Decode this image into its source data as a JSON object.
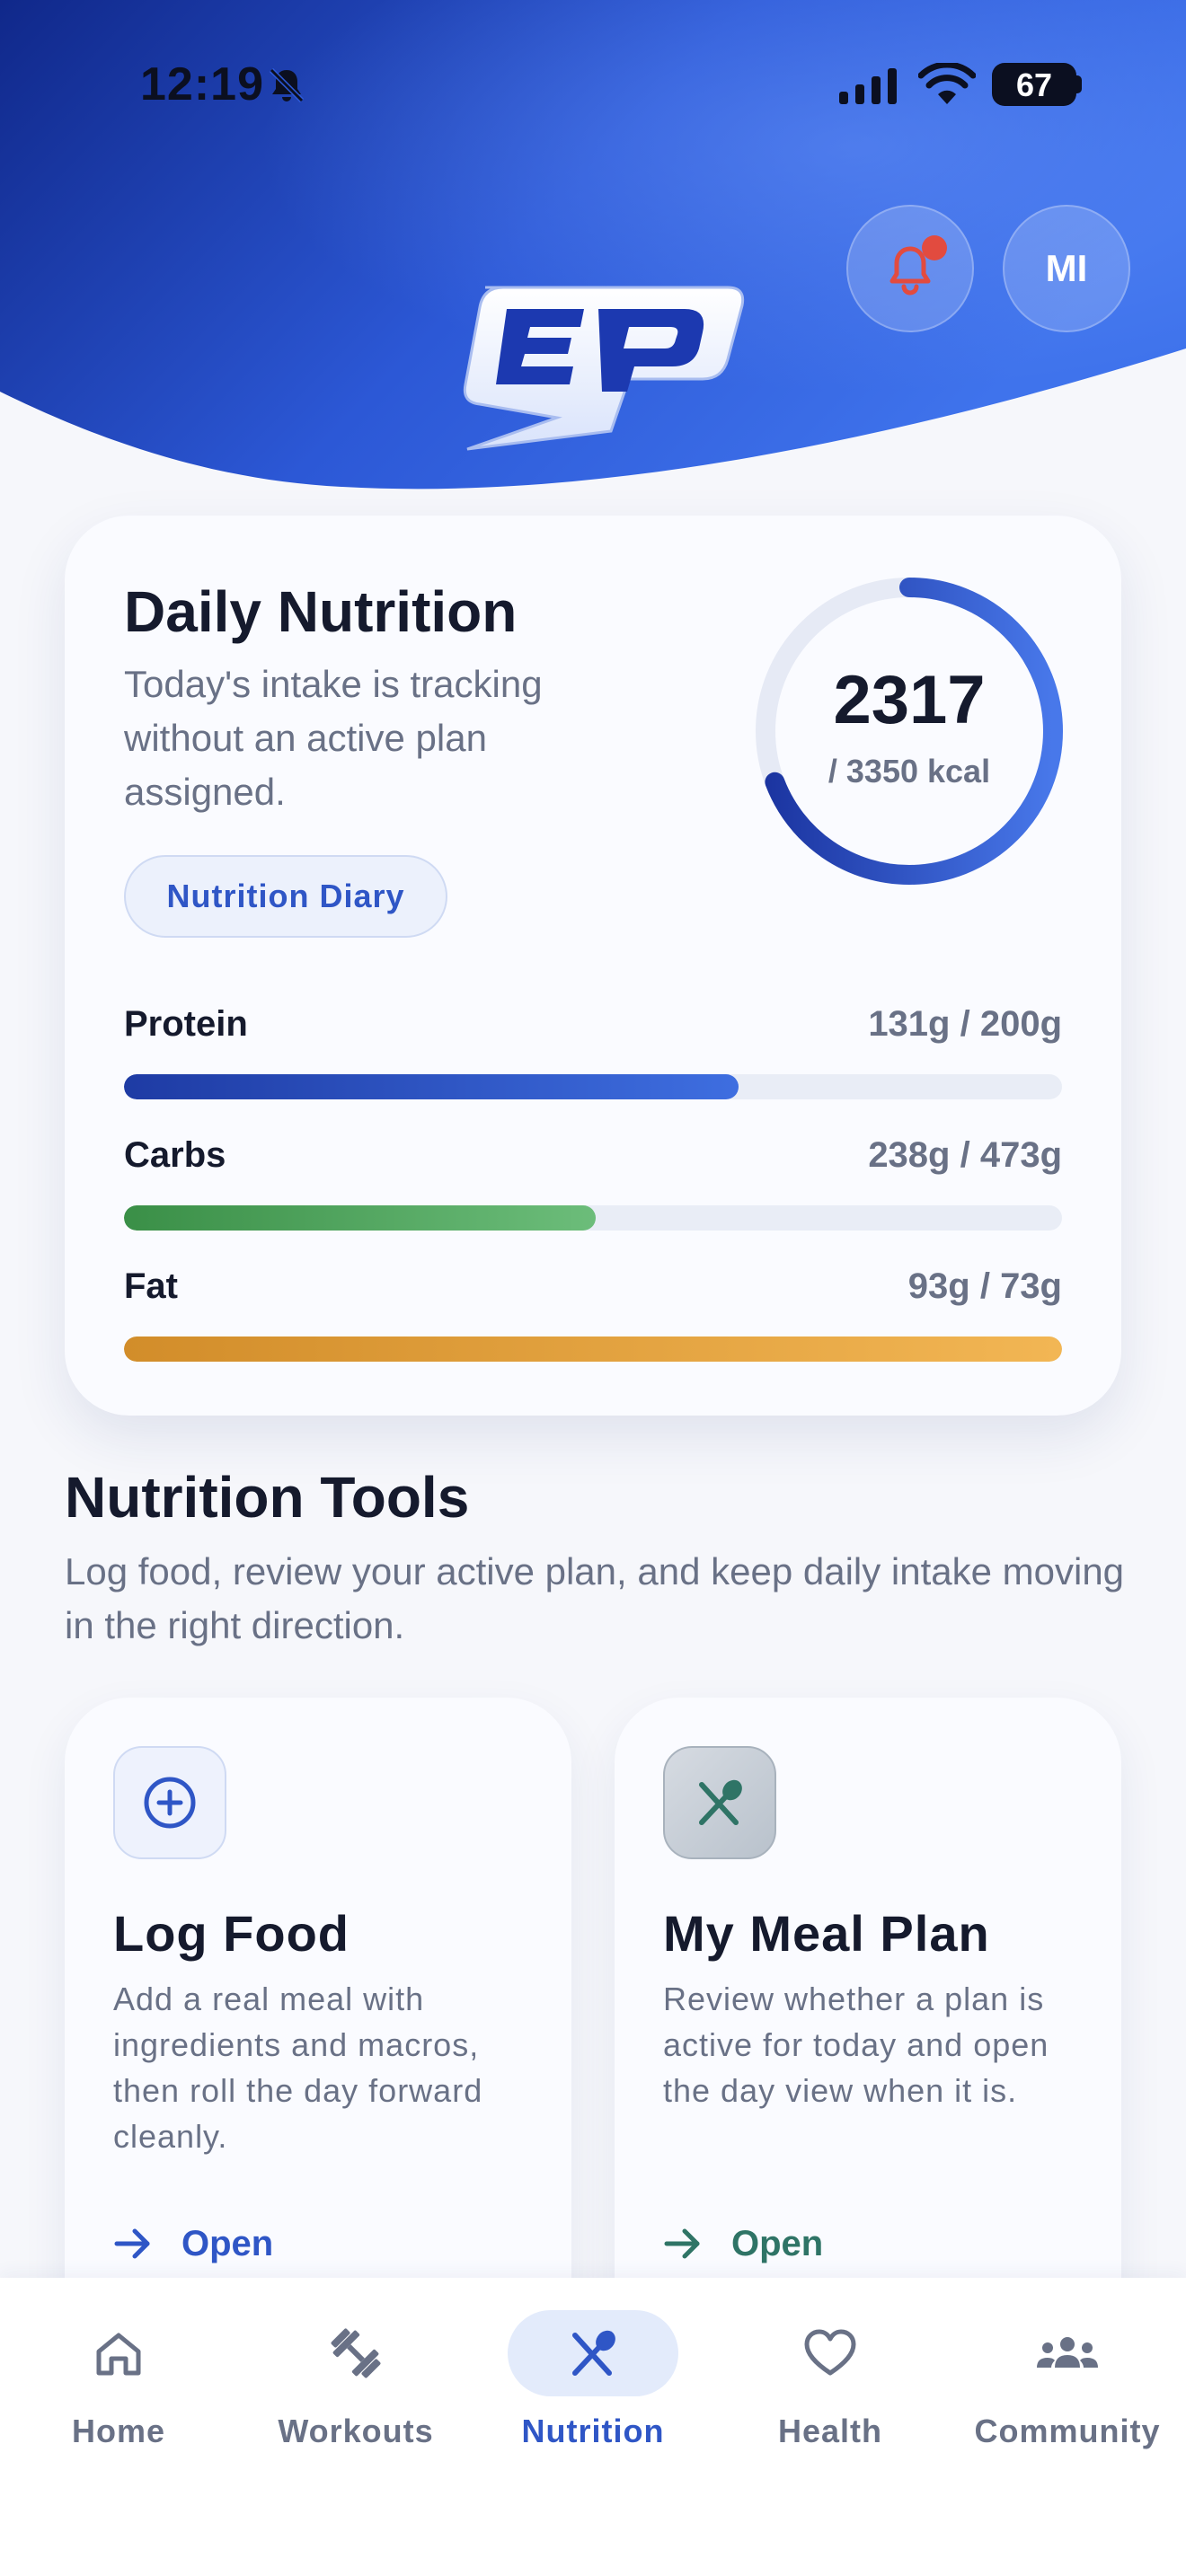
{
  "status_bar": {
    "time": "12:19",
    "battery": "67"
  },
  "header": {
    "avatar_initials": "MI",
    "logo_text": "EP"
  },
  "daily_nutrition": {
    "title": "Daily Nutrition",
    "subtitle": "Today's intake is tracking without an active plan assigned.",
    "diary_button": "Nutrition Diary",
    "calories_value": "2317",
    "calories_goal": "/ 3350 kcal",
    "calories_fraction": 0.692,
    "macros": [
      {
        "label": "Protein",
        "value": "131g / 200g",
        "fraction": 0.655
      },
      {
        "label": "Carbs",
        "value": "238g / 473g",
        "fraction": 0.503
      },
      {
        "label": "Fat",
        "value": "93g / 73g",
        "fraction": 1.0
      }
    ]
  },
  "tools": {
    "title": "Nutrition Tools",
    "subtitle": "Log food, review your active plan, and keep daily intake moving in the right direction.",
    "cards": [
      {
        "title": "Log Food",
        "description": "Add a real meal with ingredients and macros, then roll the day forward cleanly.",
        "action": "Open",
        "icon": "plus-circle-icon"
      },
      {
        "title": "My Meal Plan",
        "description": "Review whether a plan is active for today and open the day view when it is.",
        "action": "Open",
        "icon": "utensils-icon"
      }
    ]
  },
  "bottom_nav": {
    "items": [
      {
        "label": "Home",
        "icon": "home-icon"
      },
      {
        "label": "Workouts",
        "icon": "dumbbell-icon"
      },
      {
        "label": "Nutrition",
        "icon": "utensils-icon",
        "active": true
      },
      {
        "label": "Health",
        "icon": "heart-icon"
      },
      {
        "label": "Community",
        "icon": "group-icon"
      }
    ]
  },
  "colors": {
    "brand_blue": "#2f56c6",
    "header_dark": "#1b34a0",
    "protein": "#3e6ee0",
    "carbs": "#4fa85d",
    "fat": "#e6a63f",
    "alert_red": "#e24b3f"
  }
}
